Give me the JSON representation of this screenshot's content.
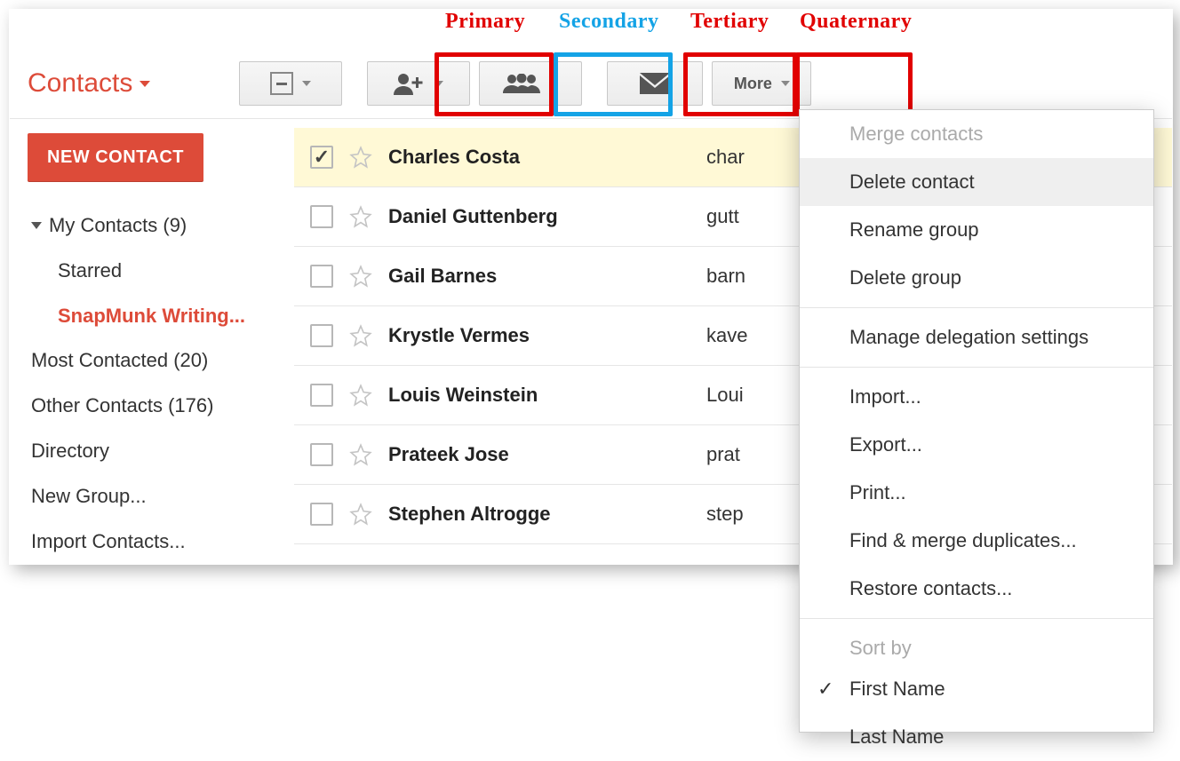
{
  "annotations": {
    "primary": "Primary",
    "secondary": "Secondary",
    "tertiary": "Tertiary",
    "quaternary": "Quaternary"
  },
  "app_title": "Contacts",
  "new_button": "NEW CONTACT",
  "nav": {
    "my_contacts": "My Contacts (9)",
    "starred": "Starred",
    "snapmunk": "SnapMunk Writing...",
    "most_contacted": "Most Contacted (20)",
    "other": "Other Contacts (176)",
    "directory": "Directory",
    "new_group": "New Group...",
    "import": "Import Contacts..."
  },
  "toolbar": {
    "more": "More"
  },
  "rows": [
    {
      "name": "Charles Costa",
      "email": "char",
      "selected": true
    },
    {
      "name": "Daniel Guttenberg",
      "email": "gutt",
      "selected": false
    },
    {
      "name": "Gail Barnes",
      "email": "barn",
      "selected": false
    },
    {
      "name": "Krystle Vermes",
      "email": "kave",
      "selected": false
    },
    {
      "name": "Louis Weinstein",
      "email": "Loui",
      "selected": false
    },
    {
      "name": "Prateek Jose",
      "email": "prat",
      "selected": false
    },
    {
      "name": "Stephen Altrogge",
      "email": "step",
      "selected": false
    }
  ],
  "menu": {
    "merge": "Merge contacts",
    "delete_contact": "Delete contact",
    "rename_group": "Rename group",
    "delete_group": "Delete group",
    "manage": "Manage delegation settings",
    "import": "Import...",
    "export": "Export...",
    "print": "Print...",
    "find": "Find & merge duplicates...",
    "restore": "Restore contacts...",
    "sort_by": "Sort by",
    "first_name": "First Name",
    "last_name": "Last Name"
  }
}
